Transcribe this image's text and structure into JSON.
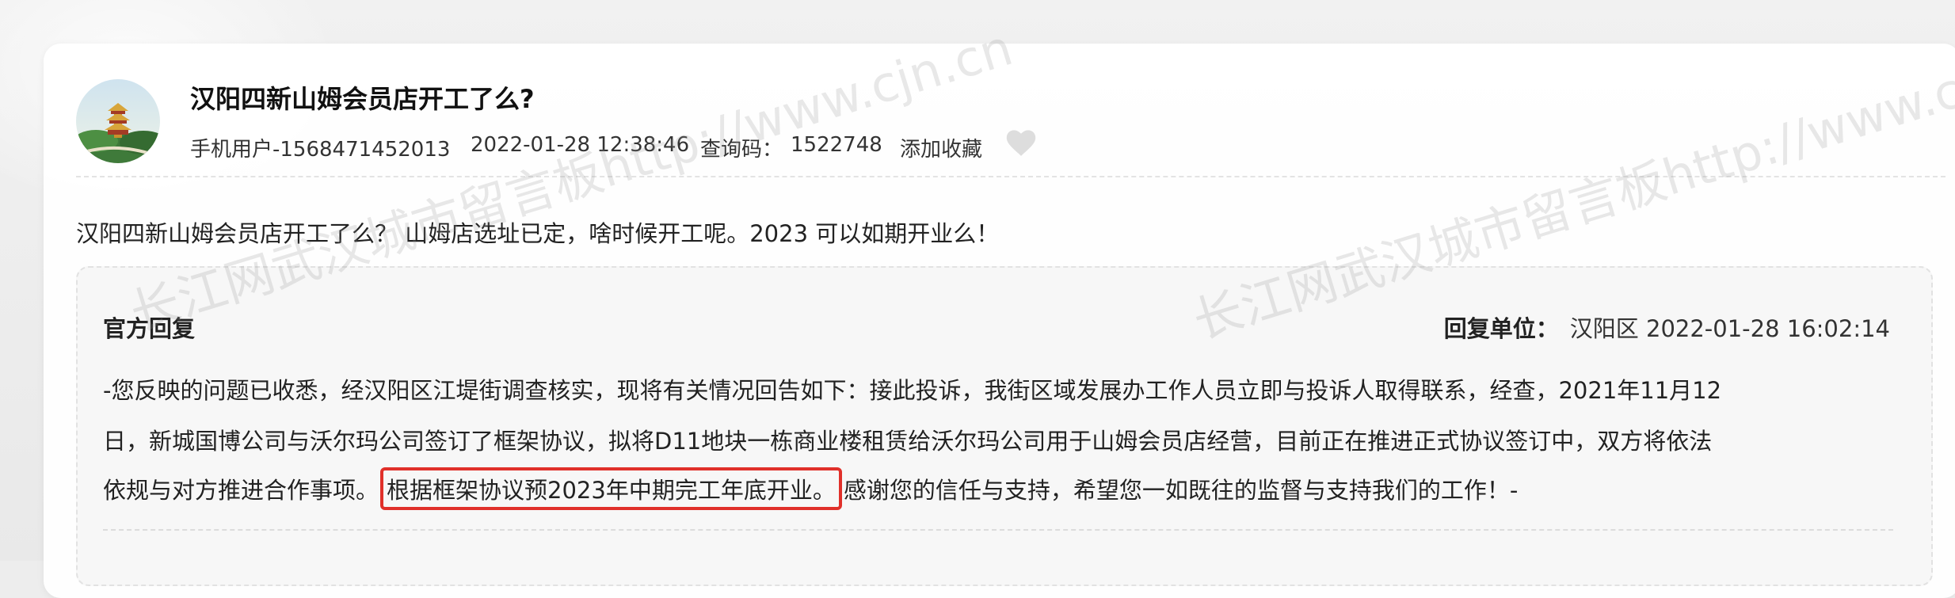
{
  "post": {
    "title": "汉阳四新山姆会员店开工了么?",
    "author": "手机用户-1568471452013",
    "datetime": "2022-01-28 12:38:46",
    "query_code_label": "查询码：",
    "query_code": "1522748",
    "favorite_label": "添加收藏",
    "question": "汉阳四新山姆会员店开工了么？ 山姆店选址已定，啥时候开工呢。2023 可以如期开业么！"
  },
  "reply": {
    "header": "官方回复",
    "unit_label": "回复单位：",
    "unit": "汉阳区",
    "datetime": "2022-01-28 16:02:14",
    "line1": "-您反映的问题已收悉，经汉阳区江堤街调查核实，现将有关情况回告如下：接此投诉，我街区域发展办工作人员立即与投诉人取得联系，经查，2021年11月12",
    "line2": "日，新城国博公司与沃尔玛公司签订了框架协议，拟将D11地块一栋商业楼租赁给沃尔玛公司用于山姆会员店经营，目前正在推进正式协议签订中，双方将依法",
    "line3_before": "依规与对方推进合作事项。",
    "line3_highlight": "根据框架协议预2023年中期完工年底开业。",
    "line3_after": "感谢您的信任与支持，希望您一如既往的监督与支持我们的工作！-"
  },
  "watermark": {
    "text1": "长江网武汉城市留言板http://www.cjn.cn",
    "text2": "长江网武汉城市留言板http://www.cjn.cn"
  },
  "icons": {
    "avatar": "yellow-crane-tower-avatar",
    "favorite": "heart-icon"
  },
  "colors": {
    "highlight_border": "#e0302a",
    "watermark": "#969696"
  }
}
